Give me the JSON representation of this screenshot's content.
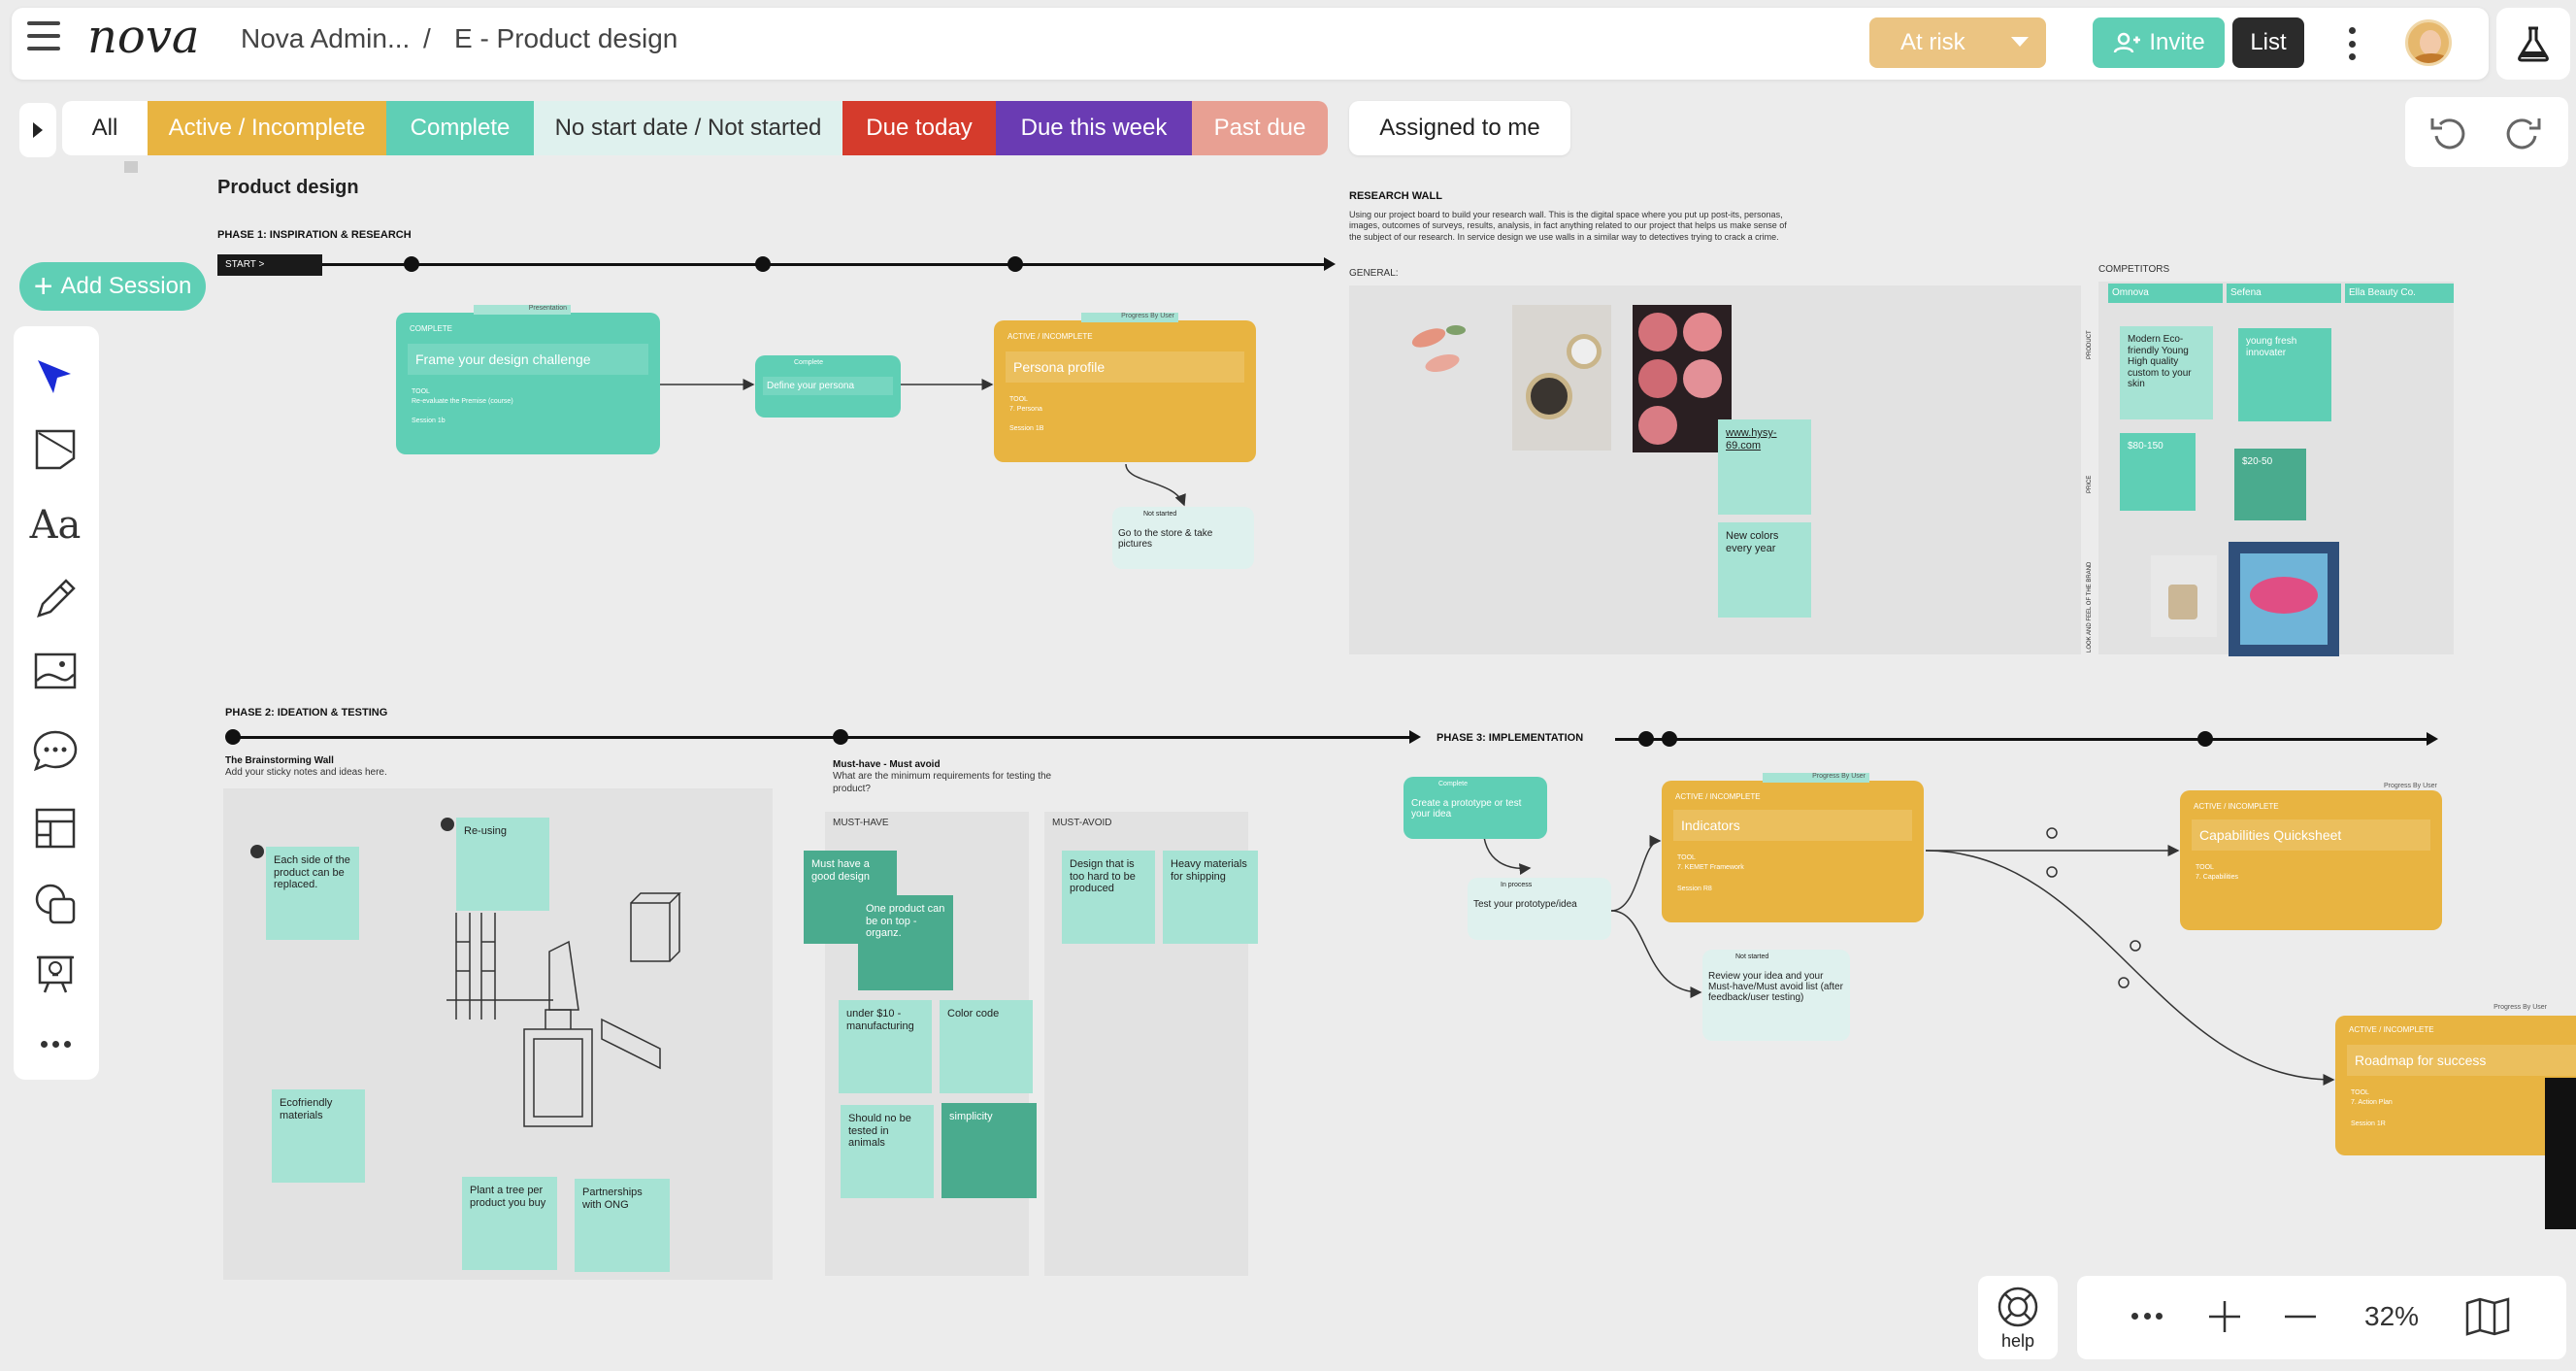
{
  "app": {
    "logo": "nova"
  },
  "breadcrumb": {
    "workspace": "Nova Admin...",
    "separator": "/",
    "project": "E - Product design"
  },
  "header": {
    "status_label": "At risk",
    "invite_label": "Invite",
    "list_label": "List"
  },
  "filters": [
    "All",
    "Active / Incomplete",
    "Complete",
    "No start date / Not started",
    "Due today",
    "Due this week",
    "Past due"
  ],
  "assigned_label": "Assigned to me",
  "add_session_label": "Add Session",
  "toolbar": {
    "text_tool_label": "Aa"
  },
  "zoom": {
    "level": "32%"
  },
  "help_label": "help",
  "canvas": {
    "title": "Product design",
    "phase1": "PHASE 1: INSPIRATION & RESEARCH",
    "start_label": "START >",
    "phase2": "PHASE 2: IDEATION & TESTING",
    "phase3": "PHASE 3: IMPLEMENTATION",
    "research_wall": "RESEARCH WALL",
    "research_desc": "Using our project board to build your research wall. This is the digital space where you put up post-its, personas, images, outcomes of surveys, results, analysis, in fact anything related to our project that helps us make sense of the subject of our research. In service design we use walls in a similar way to detectives trying to crack a crime.",
    "general_label": "GENERAL:",
    "competitors_label": "COMPETITORS",
    "competitors": [
      "Omnova",
      "Sefena",
      "Ella Beauty Co."
    ],
    "competitor_rows": [
      "PRODUCT",
      "PRICE",
      "LOOK AND FEEL OF THE BRAND"
    ],
    "research_notes": [
      "www.hysy-69.com",
      "New colors every year"
    ],
    "comp_notes": [
      "Modern Eco-friendly Young High quality custom to your skin",
      "young fresh innovater",
      "$80-150",
      "$20-50"
    ],
    "brainstorm_title": "The Brainstorming Wall",
    "brainstorm_sub": "Add your sticky notes and ideas here.",
    "brainstorm_notes": [
      "Each side of the product can be replaced.",
      "Re-using",
      "Ecofriendly materials",
      "Plant a tree per product you buy",
      "Partnerships with ONG"
    ],
    "must_title": "Must-have - Must avoid",
    "must_sub": "What are the minimum requirements for testing the product?",
    "must_have_label": "MUST-HAVE",
    "must_avoid_label": "MUST-AVOID",
    "must_have_notes": [
      "Must have a good design",
      "One product can be on top - organz.",
      "under $10 - manufacturing",
      "Color code",
      "Should no be tested in animals",
      "simplicity"
    ],
    "must_avoid_notes": [
      "Design that is too hard to be produced",
      "Heavy materials for shipping"
    ],
    "cards": {
      "frame": {
        "status": "COMPLETE",
        "title": "Frame your design challenge",
        "tool": "TOOL",
        "tool_name": "Re-evaluate the Premise (course)",
        "session": "Session 1b",
        "tag": "Presentation"
      },
      "define": {
        "status": "Complete",
        "title": "Define your persona"
      },
      "persona": {
        "status": "ACTIVE / INCOMPLETE",
        "title": "Persona profile",
        "tool": "TOOL",
        "tool_name": "7. Persona",
        "session": "Session 1B",
        "tag": "Progress By User"
      },
      "store": {
        "status": "Not started",
        "title": "Go to the store & take pictures"
      },
      "prototype": {
        "status": "Complete",
        "title": "Create a prototype or test your idea"
      },
      "test": {
        "status": "In process",
        "title": "Test your prototype/idea"
      },
      "indicators": {
        "status": "ACTIVE / INCOMPLETE",
        "title": "Indicators",
        "tool": "TOOL",
        "tool_name": "7. KEMET Framework",
        "session": "Session R8",
        "tag": "Progress By User"
      },
      "review": {
        "status": "Not started",
        "title": "Review your idea and your Must-have/Must avoid list (after feedback/user testing)"
      },
      "capabilities": {
        "status": "ACTIVE / INCOMPLETE",
        "title": "Capabilities Quicksheet",
        "tool": "TOOL",
        "tool_name": "7. Capabilities",
        "tag": "Progress By User"
      },
      "roadmap": {
        "status": "ACTIVE / INCOMPLETE",
        "title": "Roadmap for success",
        "tool": "TOOL",
        "tool_name": "7. Action Plan",
        "session": "Session 1R",
        "tag": "Progress By User"
      }
    }
  },
  "colors": {
    "teal": "#5fcfb5",
    "mint": "#a6e3d4",
    "dark_teal": "#4aab8e",
    "amber": "#e8b441",
    "red": "#d53b2c",
    "purple": "#6a3bb3",
    "salmon": "#e8a093",
    "tan": "#ebc482"
  }
}
